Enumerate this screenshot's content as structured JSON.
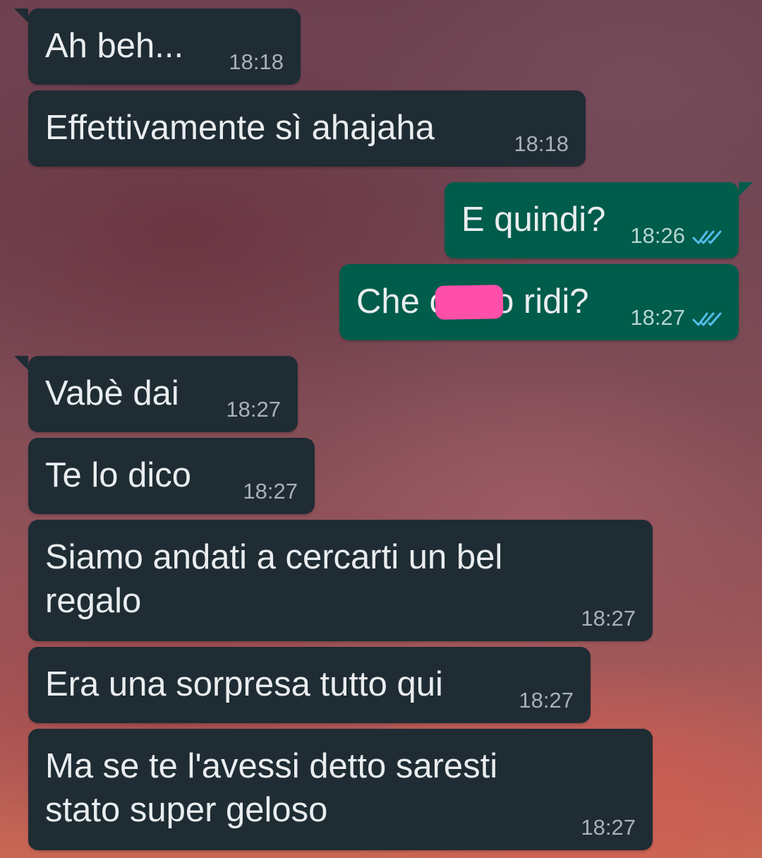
{
  "messages": [
    {
      "direction": "incoming",
      "text": "Ah beh...",
      "time": "18:18"
    },
    {
      "direction": "incoming",
      "text": "Effettivamente sì ahajaha",
      "time": "18:18"
    },
    {
      "direction": "outgoing",
      "text": "E quindi?",
      "time": "18:26",
      "status_icon": "double-check-icon"
    },
    {
      "direction": "outgoing",
      "text": "Che c     o ridi?",
      "time": "18:27",
      "status_icon": "double-check-icon",
      "redaction_color": "#ff4fa8"
    },
    {
      "direction": "incoming",
      "text": "Vabè dai",
      "time": "18:27"
    },
    {
      "direction": "incoming",
      "text": "Te lo dico",
      "time": "18:27"
    },
    {
      "direction": "incoming",
      "text": "Siamo andati a cercarti un bel\nregalo",
      "time": "18:27"
    },
    {
      "direction": "incoming",
      "text": "Era una sorpresa tutto qui",
      "time": "18:27"
    },
    {
      "direction": "incoming",
      "text": "Ma se te l'avessi detto saresti\nstato super geloso",
      "time": "18:27"
    }
  ],
  "colors": {
    "incoming_bubble": "#1f2c34",
    "outgoing_bubble": "#005c4b",
    "message_text": "#e9edef",
    "read_ticks": "#53bdeb"
  }
}
